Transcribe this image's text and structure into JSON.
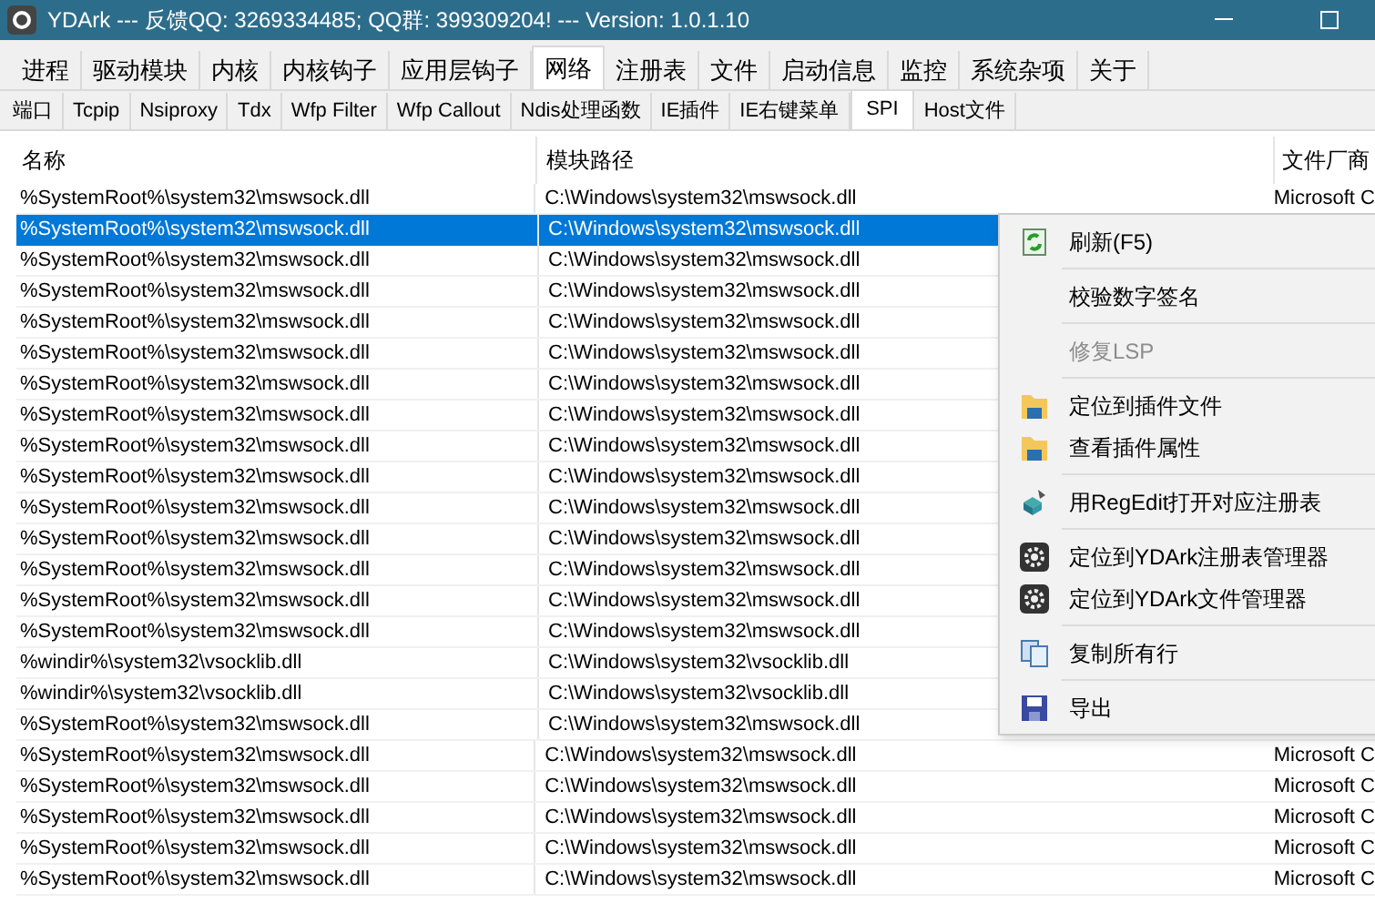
{
  "window": {
    "title": "YDArk --- 反馈QQ: 3269334485; QQ群: 399309204! --- Version: 1.0.1.10"
  },
  "main_tabs": [
    {
      "label": "进程",
      "selected": false
    },
    {
      "label": "驱动模块",
      "selected": false
    },
    {
      "label": "内核",
      "selected": false
    },
    {
      "label": "内核钩子",
      "selected": false
    },
    {
      "label": "应用层钩子",
      "selected": false
    },
    {
      "label": "网络",
      "selected": true
    },
    {
      "label": "注册表",
      "selected": false
    },
    {
      "label": "文件",
      "selected": false
    },
    {
      "label": "启动信息",
      "selected": false
    },
    {
      "label": "监控",
      "selected": false
    },
    {
      "label": "系统杂项",
      "selected": false
    },
    {
      "label": "关于",
      "selected": false
    }
  ],
  "sub_tabs": [
    {
      "label": "端口",
      "selected": false
    },
    {
      "label": "Tcpip",
      "selected": false
    },
    {
      "label": "Nsiproxy",
      "selected": false
    },
    {
      "label": "Tdx",
      "selected": false
    },
    {
      "label": "Wfp Filter",
      "selected": false
    },
    {
      "label": "Wfp Callout",
      "selected": false
    },
    {
      "label": "Ndis处理函数",
      "selected": false
    },
    {
      "label": "IE插件",
      "selected": false
    },
    {
      "label": "IE右键菜单",
      "selected": false
    },
    {
      "label": "SPI",
      "selected": true
    },
    {
      "label": "Host文件",
      "selected": false
    }
  ],
  "table": {
    "columns": [
      "名称",
      "模块路径",
      "文件厂商"
    ],
    "rows": [
      {
        "name": "%SystemRoot%\\system32\\mswsock.dll",
        "path": "C:\\Windows\\system32\\mswsock.dll",
        "vendor": "Microsoft C",
        "selected": false
      },
      {
        "name": "%SystemRoot%\\system32\\mswsock.dll",
        "path": "C:\\Windows\\system32\\mswsock.dll",
        "selected": true
      },
      {
        "name": "%SystemRoot%\\system32\\mswsock.dll",
        "path": "C:\\Windows\\system32\\mswsock.dll",
        "selected": false
      },
      {
        "name": "%SystemRoot%\\system32\\mswsock.dll",
        "path": "C:\\Windows\\system32\\mswsock.dll",
        "selected": false
      },
      {
        "name": "%SystemRoot%\\system32\\mswsock.dll",
        "path": "C:\\Windows\\system32\\mswsock.dll",
        "selected": false
      },
      {
        "name": "%SystemRoot%\\system32\\mswsock.dll",
        "path": "C:\\Windows\\system32\\mswsock.dll",
        "selected": false
      },
      {
        "name": "%SystemRoot%\\system32\\mswsock.dll",
        "path": "C:\\Windows\\system32\\mswsock.dll",
        "selected": false
      },
      {
        "name": "%SystemRoot%\\system32\\mswsock.dll",
        "path": "C:\\Windows\\system32\\mswsock.dll",
        "selected": false
      },
      {
        "name": "%SystemRoot%\\system32\\mswsock.dll",
        "path": "C:\\Windows\\system32\\mswsock.dll",
        "selected": false
      },
      {
        "name": "%SystemRoot%\\system32\\mswsock.dll",
        "path": "C:\\Windows\\system32\\mswsock.dll",
        "selected": false
      },
      {
        "name": "%SystemRoot%\\system32\\mswsock.dll",
        "path": "C:\\Windows\\system32\\mswsock.dll",
        "selected": false
      },
      {
        "name": "%SystemRoot%\\system32\\mswsock.dll",
        "path": "C:\\Windows\\system32\\mswsock.dll",
        "selected": false
      },
      {
        "name": "%SystemRoot%\\system32\\mswsock.dll",
        "path": "C:\\Windows\\system32\\mswsock.dll",
        "selected": false
      },
      {
        "name": "%SystemRoot%\\system32\\mswsock.dll",
        "path": "C:\\Windows\\system32\\mswsock.dll",
        "selected": false
      },
      {
        "name": "%SystemRoot%\\system32\\mswsock.dll",
        "path": "C:\\Windows\\system32\\mswsock.dll",
        "selected": false
      },
      {
        "name": "%windir%\\system32\\vsocklib.dll",
        "path": "C:\\Windows\\system32\\vsocklib.dll",
        "selected": false
      },
      {
        "name": "%windir%\\system32\\vsocklib.dll",
        "path": "C:\\Windows\\system32\\vsocklib.dll",
        "selected": false
      },
      {
        "name": "%SystemRoot%\\system32\\mswsock.dll",
        "path": "C:\\Windows\\system32\\mswsock.dll",
        "selected": false
      },
      {
        "name": "%SystemRoot%\\system32\\mswsock.dll",
        "path": "C:\\Windows\\system32\\mswsock.dll",
        "vendor": "Microsoft C",
        "selected": false
      },
      {
        "name": "%SystemRoot%\\system32\\mswsock.dll",
        "path": "C:\\Windows\\system32\\mswsock.dll",
        "vendor": "Microsoft C",
        "selected": false
      },
      {
        "name": "%SystemRoot%\\system32\\mswsock.dll",
        "path": "C:\\Windows\\system32\\mswsock.dll",
        "vendor": "Microsoft C",
        "selected": false
      },
      {
        "name": "%SystemRoot%\\system32\\mswsock.dll",
        "path": "C:\\Windows\\system32\\mswsock.dll",
        "vendor": "Microsoft C",
        "selected": false
      },
      {
        "name": "%SystemRoot%\\system32\\mswsock.dll",
        "path": "C:\\Windows\\system32\\mswsock.dll",
        "vendor": "Microsoft C",
        "selected": false
      }
    ]
  },
  "context_menu": [
    {
      "kind": "item",
      "label": "刷新(F5)",
      "disabled": false
    },
    {
      "kind": "separator"
    },
    {
      "kind": "item",
      "label": "校验数字签名",
      "disabled": false
    },
    {
      "kind": "separator"
    },
    {
      "kind": "item",
      "label": "修复LSP",
      "disabled": true
    },
    {
      "kind": "separator"
    },
    {
      "kind": "item",
      "label": "定位到插件文件",
      "disabled": false
    },
    {
      "kind": "item",
      "label": "查看插件属性",
      "disabled": false
    },
    {
      "kind": "separator"
    },
    {
      "kind": "item",
      "label": "用RegEdit打开对应注册表",
      "disabled": false
    },
    {
      "kind": "separator"
    },
    {
      "kind": "item",
      "label": "定位到YDArk注册表管理器",
      "disabled": false
    },
    {
      "kind": "item",
      "label": "定位到YDArk文件管理器",
      "disabled": false
    },
    {
      "kind": "separator"
    },
    {
      "kind": "item",
      "label": "复制所有行",
      "disabled": false
    },
    {
      "kind": "separator"
    },
    {
      "kind": "item",
      "label": "导出",
      "disabled": false
    }
  ]
}
